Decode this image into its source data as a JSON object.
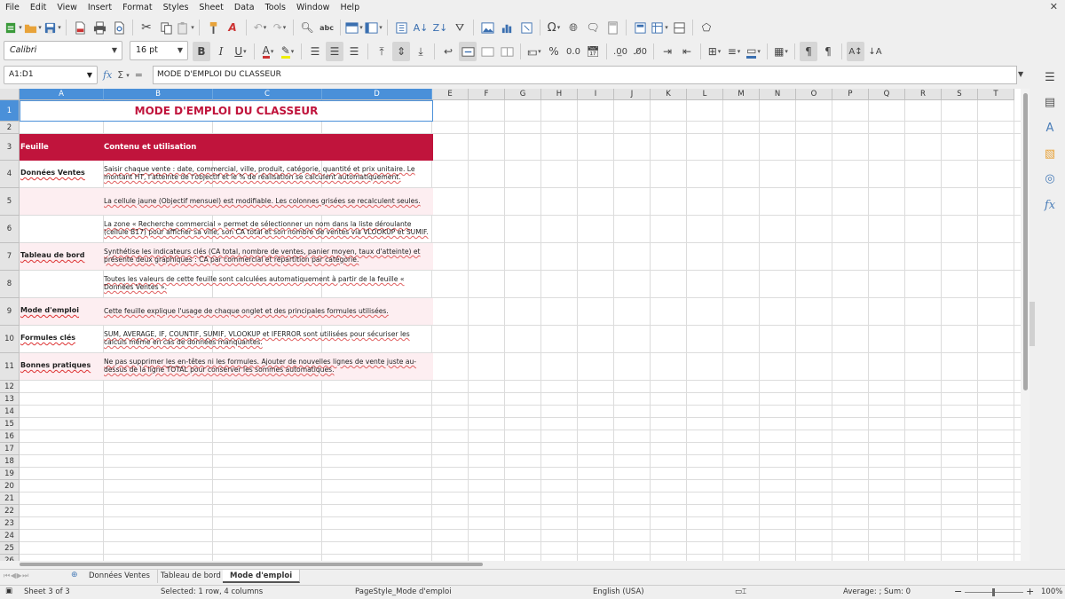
{
  "menubar": [
    "File",
    "Edit",
    "View",
    "Insert",
    "Format",
    "Styles",
    "Sheet",
    "Data",
    "Tools",
    "Window",
    "Help"
  ],
  "font": {
    "name": "Calibri",
    "size": "16 pt"
  },
  "namebox": "A1:D1",
  "formula": {
    "fx": "fx",
    "sum": "Σ",
    "eq": "=",
    "content": "MODE D'EMPLOI DU CLASSEUR"
  },
  "columns": [
    "A",
    "B",
    "C",
    "D",
    "E",
    "F",
    "G",
    "H",
    "I",
    "J",
    "K",
    "L",
    "M",
    "N",
    "O",
    "P",
    "Q",
    "R",
    "S",
    "T"
  ],
  "rows": [
    "1",
    "2",
    "3",
    "4",
    "5",
    "6",
    "7",
    "8",
    "9",
    "10",
    "11",
    "12",
    "13",
    "14",
    "15",
    "16",
    "17",
    "18",
    "19",
    "20",
    "21",
    "22",
    "23",
    "24",
    "25",
    "26"
  ],
  "sheet": {
    "title": "MODE D'EMPLOI DU CLASSEUR",
    "header": {
      "col_a": "Feuille",
      "col_b": "Contenu et utilisation"
    },
    "rows": [
      {
        "a": "Données Ventes",
        "b": "Saisir chaque vente : date, commercial, ville, produit, catégorie, quantité et prix unitaire. Le montant HT, l'atteinte de l'objectif et le % de réalisation se calculent automatiquement."
      },
      {
        "a": "",
        "b": "La cellule jaune (Objectif mensuel) est modifiable. Les colonnes grisées se recalculent seules."
      },
      {
        "a": "",
        "b": "La zone « Recherche commercial » permet de sélectionner un nom dans la liste déroulante (cellule B17) pour afficher sa ville, son CA total et son nombre de ventes via VLOOKUP et SUMIF."
      },
      {
        "a": "Tableau de bord",
        "b": "Synthétise les indicateurs clés (CA total, nombre de ventes, panier moyen, taux d'atteinte) et présente deux graphiques : CA par commercial et répartition par catégorie."
      },
      {
        "a": "",
        "b": "Toutes les valeurs de cette feuille sont calculées automatiquement à partir de la feuille « Données Ventes »."
      },
      {
        "a": "Mode d'emploi",
        "b": "Cette feuille explique l'usage de chaque onglet et des principales formules utilisées."
      },
      {
        "a": "Formules clés",
        "b": "SUM, AVERAGE, IF, COUNTIF, SUMIF, VLOOKUP et IFERROR sont utilisées pour sécuriser les calculs même en cas de données manquantes."
      },
      {
        "a": "Bonnes pratiques",
        "b": "Ne pas supprimer les en-têtes ni les formules. Ajouter de nouvelles lignes de vente juste au-dessus de la ligne TOTAL pour conserver les sommes automatiques."
      }
    ]
  },
  "tabs": [
    "Données Ventes",
    "Tableau de bord",
    "Mode d'emploi"
  ],
  "active_tab": "Mode d'emploi",
  "status": {
    "sheet": "Sheet 3 of 3",
    "selected": "Selected: 1 row, 4 columns",
    "pagestyle": "PageStyle_Mode d'emploi",
    "language": "English (USA)",
    "aggregate": "Average: ; Sum: 0",
    "zoom": "100%"
  },
  "colors": {
    "accent": "#c0143c",
    "pink_row": "#fdeef1",
    "selection": "#4a90d9"
  }
}
